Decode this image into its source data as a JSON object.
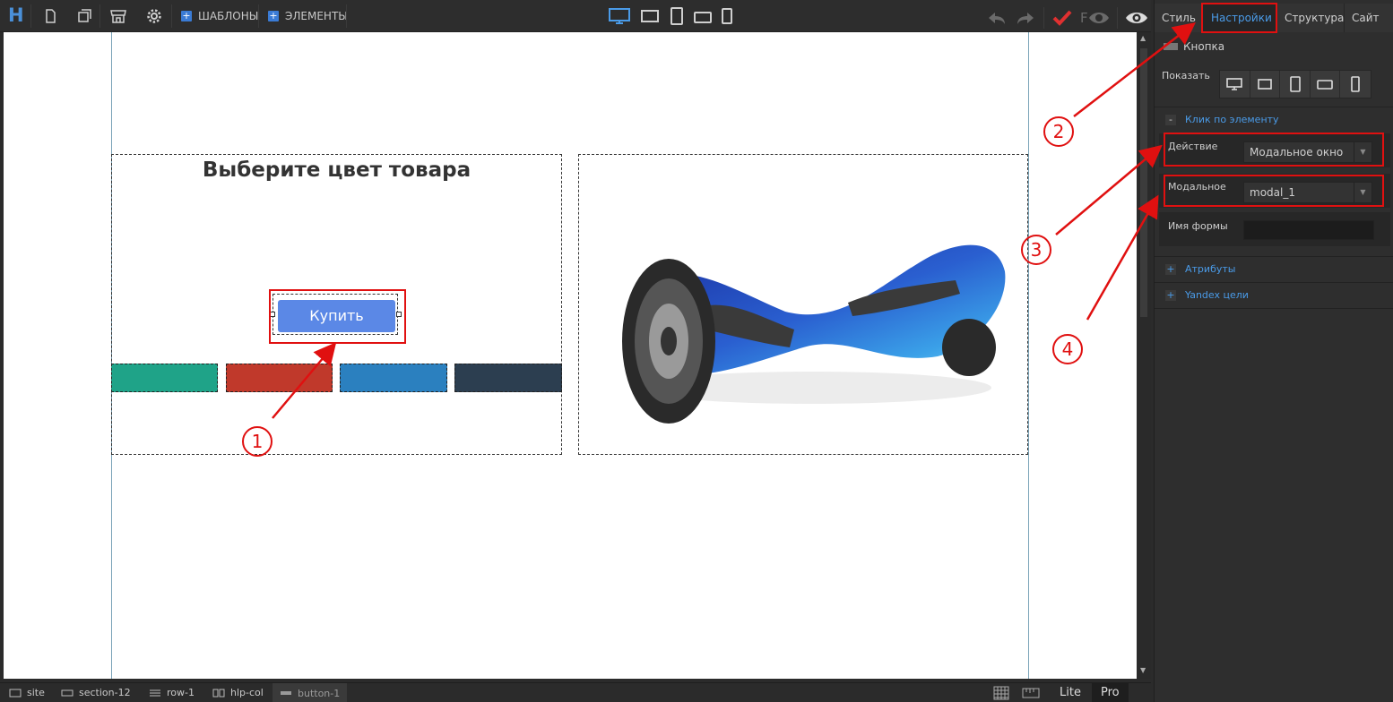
{
  "toolbar": {
    "logo": "H",
    "templates_label": "ШАБЛОНЫ",
    "elements_label": "ЭЛЕМЕНТЫ",
    "plus": "+",
    "f_label": "F"
  },
  "canvas": {
    "heading": "Выберите цвет товара",
    "swatch_colors": [
      "#1fa388",
      "#c0392b",
      "#2b80bf",
      "#2c3e50"
    ],
    "buy_button": "Купить",
    "product_image": "hoverboard"
  },
  "panel": {
    "tabs": [
      "Стиль",
      "Настройки",
      "Структура",
      "Сайт"
    ],
    "active_tab": "Настройки",
    "element_name": "Кнопка",
    "show_label": "Показать",
    "click_section": "Клик по элементу",
    "collapse": "-",
    "action_label": "Действие",
    "action_value": "Модальное окно",
    "modal_label": "Модальное",
    "modal_value": "modal_1",
    "form_name_label": "Имя формы",
    "attributes": "Атрибуты",
    "yandex_goals": "Yandex цели",
    "expand": "+"
  },
  "statusbar": {
    "crumbs": [
      "site",
      "section-12",
      "row-1",
      "hlp-col",
      "button-1"
    ],
    "modes": [
      "Lite",
      "Pro"
    ],
    "active_mode": "Pro"
  },
  "annotations": {
    "numbers": [
      "1",
      "2",
      "3",
      "4"
    ],
    "color": "#e01010"
  }
}
